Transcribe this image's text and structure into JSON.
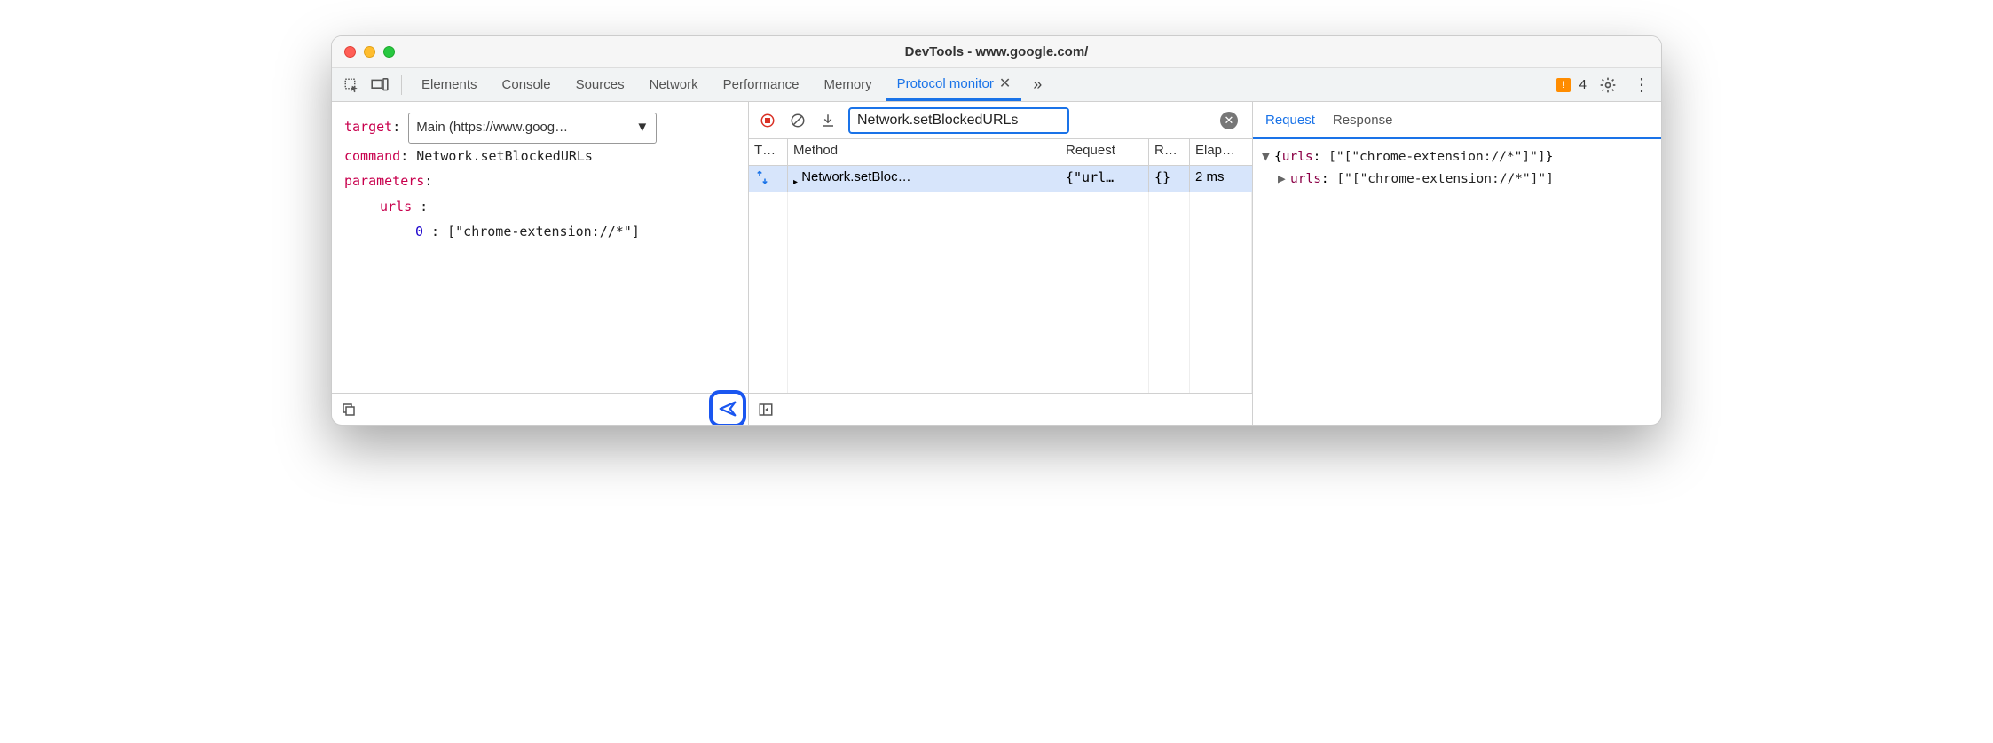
{
  "window": {
    "title": "DevTools - www.google.com/"
  },
  "tabs": {
    "items": [
      "Elements",
      "Console",
      "Sources",
      "Network",
      "Performance",
      "Memory",
      "Protocol monitor"
    ],
    "active_index": 6,
    "warning_count": "4"
  },
  "left": {
    "target_label": "target",
    "target_value": "Main (https://www.goog…",
    "command_label": "command",
    "command_value": "Network.setBlockedURLs",
    "parameters_label": "parameters",
    "param_key": "urls",
    "param_index": "0",
    "param_value": "[\"chrome-extension://*\"]"
  },
  "mid": {
    "filter_value": "Network.setBlockedURLs",
    "columns": {
      "type": "T…",
      "method": "Method",
      "request": "Request",
      "response": "R…",
      "elapsed": "Elap…"
    },
    "row": {
      "method": "Network.setBloc…",
      "request": "{\"url…",
      "response": "{}",
      "elapsed": "2 ms"
    }
  },
  "right": {
    "tabs": {
      "request": "Request",
      "response": "Response",
      "active": "request"
    },
    "line1_key": "urls",
    "line1_val": "[\"[\"chrome-extension://*\"]\"]",
    "line2_key": "urls",
    "line2_val": "[\"[\"chrome-extension://*\"]\"]"
  }
}
